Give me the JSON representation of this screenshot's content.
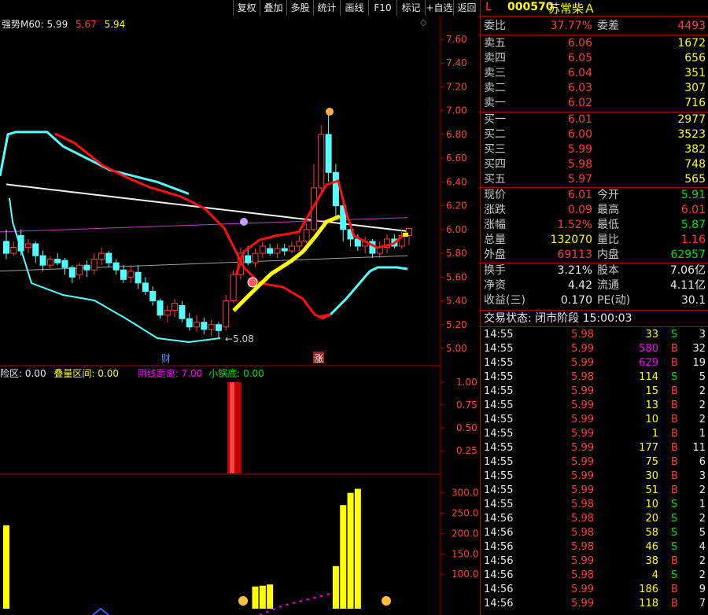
{
  "toolbar": [
    "复权",
    "叠加",
    "多股",
    "统计",
    "画线",
    "F10",
    "标记",
    "+自选",
    "返回"
  ],
  "main_legend": {
    "prefix": "强势M60: 5.99",
    "v2": "5.67",
    "v3": "5.94"
  },
  "price_axis": [
    "7.60",
    "7.40",
    "7.20",
    "7.00",
    "6.80",
    "6.60",
    "6.40",
    "6.20",
    "6.00",
    "5.80",
    "5.60",
    "5.40",
    "5.20",
    "5.00"
  ],
  "low_marker": "5.08",
  "cai_label": "财",
  "zhang_label": "涨",
  "mid_legend": {
    "a": "险区: 0.00",
    "b": "叠量区间: 0.00",
    "c": "阴线距离: 7.00",
    "d": "小锅底: 0.00"
  },
  "mid_axis": [
    "1.00",
    "0.75",
    "0.50",
    "0.25"
  ],
  "vol_axis": [
    "300.0",
    "250.0",
    "200.0",
    "150.0",
    "100.0"
  ],
  "chart_data": {
    "type": "candlestick",
    "ylim": [
      5.0,
      7.6
    ],
    "candles": [
      [
        5.9,
        5.8,
        6.0,
        5.75
      ],
      [
        5.8,
        5.85,
        5.9,
        5.78
      ],
      [
        5.95,
        5.82,
        6.0,
        5.78
      ],
      [
        5.85,
        5.88,
        5.92,
        5.8
      ],
      [
        5.88,
        5.78,
        5.9,
        5.72
      ],
      [
        5.78,
        5.7,
        5.82,
        5.65
      ],
      [
        5.7,
        5.75,
        5.78,
        5.66
      ],
      [
        5.75,
        5.72,
        5.8,
        5.7
      ],
      [
        5.74,
        5.68,
        5.76,
        5.62
      ],
      [
        5.68,
        5.6,
        5.7,
        5.55
      ],
      [
        5.62,
        5.7,
        5.72,
        5.58
      ],
      [
        5.7,
        5.66,
        5.74,
        5.6
      ],
      [
        5.66,
        5.75,
        5.8,
        5.62
      ],
      [
        5.75,
        5.8,
        5.85,
        5.7
      ],
      [
        5.8,
        5.72,
        5.82,
        5.68
      ],
      [
        5.72,
        5.66,
        5.75,
        5.62
      ],
      [
        5.66,
        5.58,
        5.7,
        5.55
      ],
      [
        5.6,
        5.65,
        5.7,
        5.55
      ],
      [
        5.64,
        5.55,
        5.7,
        5.5
      ],
      [
        5.55,
        5.48,
        5.6,
        5.45
      ],
      [
        5.48,
        5.4,
        5.52,
        5.36
      ],
      [
        5.4,
        5.28,
        5.42,
        5.25
      ],
      [
        5.28,
        5.32,
        5.36,
        5.22
      ],
      [
        5.32,
        5.38,
        5.42,
        5.26
      ],
      [
        5.36,
        5.25,
        5.4,
        5.22
      ],
      [
        5.25,
        5.18,
        5.3,
        5.15
      ],
      [
        5.18,
        5.22,
        5.28,
        5.14
      ],
      [
        5.22,
        5.16,
        5.26,
        5.12
      ],
      [
        5.16,
        5.2,
        5.24,
        5.1
      ],
      [
        5.2,
        5.15,
        5.22,
        5.08
      ],
      [
        5.18,
        5.4,
        5.45,
        5.15
      ],
      [
        5.4,
        5.62,
        5.66,
        5.38
      ],
      [
        5.62,
        5.8,
        5.85,
        5.58
      ],
      [
        5.78,
        5.72,
        5.86,
        5.7
      ],
      [
        5.72,
        5.8,
        5.84,
        5.68
      ],
      [
        5.8,
        5.86,
        5.9,
        5.76
      ],
      [
        5.84,
        5.8,
        5.88,
        5.78
      ],
      [
        5.8,
        5.84,
        5.88,
        5.76
      ],
      [
        5.84,
        5.82,
        5.88,
        5.78
      ],
      [
        5.82,
        5.86,
        5.9,
        5.8
      ],
      [
        5.86,
        5.9,
        5.95,
        5.82
      ],
      [
        5.9,
        6.0,
        6.05,
        5.88
      ],
      [
        6.0,
        6.35,
        6.55,
        5.98
      ],
      [
        6.35,
        6.8,
        6.88,
        6.3
      ],
      [
        6.8,
        6.48,
        7.0,
        6.4
      ],
      [
        6.48,
        6.2,
        6.55,
        6.1
      ],
      [
        6.2,
        6.0,
        6.25,
        5.9
      ],
      [
        6.0,
        5.92,
        6.05,
        5.86
      ],
      [
        5.92,
        5.86,
        5.96,
        5.82
      ],
      [
        5.86,
        5.9,
        5.94,
        5.8
      ],
      [
        5.9,
        5.8,
        5.92,
        5.76
      ],
      [
        5.8,
        5.85,
        5.9,
        5.76
      ],
      [
        5.85,
        5.92,
        5.96,
        5.8
      ],
      [
        5.92,
        5.86,
        5.96,
        5.84
      ],
      [
        5.86,
        5.95,
        6.0,
        5.84
      ],
      [
        5.95,
        6.01,
        6.01,
        5.87
      ]
    ],
    "volume": [
      220,
      0,
      0,
      0,
      0,
      0,
      0,
      0,
      0,
      0,
      0,
      0,
      0,
      0,
      0,
      0,
      0,
      0,
      0,
      0,
      0,
      0,
      0,
      0,
      0,
      0,
      0,
      0,
      0,
      0,
      0,
      0,
      0,
      0,
      70,
      72,
      75,
      0,
      0,
      0,
      0,
      0,
      0,
      0,
      0,
      120,
      270,
      300,
      310,
      0,
      0,
      0,
      0,
      0,
      0,
      0
    ]
  },
  "stock": {
    "code": "000570",
    "name": "苏常柴Ａ",
    "flag": "L"
  },
  "weibi": {
    "label": "委比",
    "value": "37.77%",
    "label2": "委差",
    "value2": "4493"
  },
  "asks": [
    {
      "label": "卖五",
      "price": "6.06",
      "vol": "1672"
    },
    {
      "label": "卖四",
      "price": "6.05",
      "vol": "656"
    },
    {
      "label": "卖三",
      "price": "6.04",
      "vol": "351"
    },
    {
      "label": "卖二",
      "price": "6.03",
      "vol": "307"
    },
    {
      "label": "卖一",
      "price": "6.02",
      "vol": "716"
    }
  ],
  "bids": [
    {
      "label": "买一",
      "price": "6.01",
      "vol": "2977"
    },
    {
      "label": "买二",
      "price": "6.00",
      "vol": "3523"
    },
    {
      "label": "买三",
      "price": "5.99",
      "vol": "382"
    },
    {
      "label": "买四",
      "price": "5.98",
      "vol": "748"
    },
    {
      "label": "买五",
      "price": "5.97",
      "vol": "565"
    }
  ],
  "quote1": [
    {
      "l1": "现价",
      "v1": "6.01",
      "l2": "今开",
      "v2": "5.91"
    },
    {
      "l1": "涨跌",
      "v1": "0.09",
      "l2": "最高",
      "v2": "6.01"
    },
    {
      "l1": "涨幅",
      "v1": "1.52%",
      "l2": "最低",
      "v2": "5.87"
    },
    {
      "l1": "总量",
      "v1": "132070",
      "l2": "量比",
      "v2": "1.16"
    },
    {
      "l1": "外盘",
      "v1": "69113",
      "l2": "内盘",
      "v2": "62957"
    }
  ],
  "quote2": [
    {
      "l1": "换手",
      "v1": "3.21%",
      "l2": "股本",
      "v2": "7.06亿"
    },
    {
      "l1": "净资",
      "v1": "4.42",
      "l2": "流通",
      "v2": "4.11亿"
    },
    {
      "l1": "收益(三)",
      "v1": "0.170",
      "l2": "PE(动)",
      "v2": "30.1"
    }
  ],
  "trade_status": "交易状态: 闭市阶段 15:00:03",
  "ticks": [
    [
      "14:55",
      "5.98",
      "33",
      "S",
      "3"
    ],
    [
      "14:55",
      "5.99",
      "580",
      "B",
      "32"
    ],
    [
      "14:55",
      "5.99",
      "629",
      "B",
      "19"
    ],
    [
      "14:55",
      "5.98",
      "114",
      "S",
      "5"
    ],
    [
      "14:55",
      "5.99",
      "15",
      "B",
      "2"
    ],
    [
      "14:55",
      "5.99",
      "13",
      "B",
      "2"
    ],
    [
      "14:55",
      "5.99",
      "10",
      "B",
      "2"
    ],
    [
      "14:55",
      "5.99",
      "1",
      "B",
      "1"
    ],
    [
      "14:55",
      "5.99",
      "177",
      "B",
      "11"
    ],
    [
      "14:55",
      "5.99",
      "75",
      "B",
      "6"
    ],
    [
      "14:55",
      "5.99",
      "30",
      "B",
      "3"
    ],
    [
      "14:55",
      "5.99",
      "51",
      "B",
      "2"
    ],
    [
      "14:55",
      "5.98",
      "10",
      "S",
      "1"
    ],
    [
      "14:56",
      "5.98",
      "20",
      "S",
      "2"
    ],
    [
      "14:56",
      "5.98",
      "58",
      "S",
      "5"
    ],
    [
      "14:56",
      "5.98",
      "46",
      "S",
      "4"
    ],
    [
      "14:56",
      "5.99",
      "38",
      "B",
      "2"
    ],
    [
      "14:56",
      "5.98",
      "4",
      "S",
      "2"
    ],
    [
      "14:56",
      "5.99",
      "186",
      "B",
      "9"
    ],
    [
      "14:56",
      "5.99",
      "118",
      "B",
      "7"
    ]
  ]
}
